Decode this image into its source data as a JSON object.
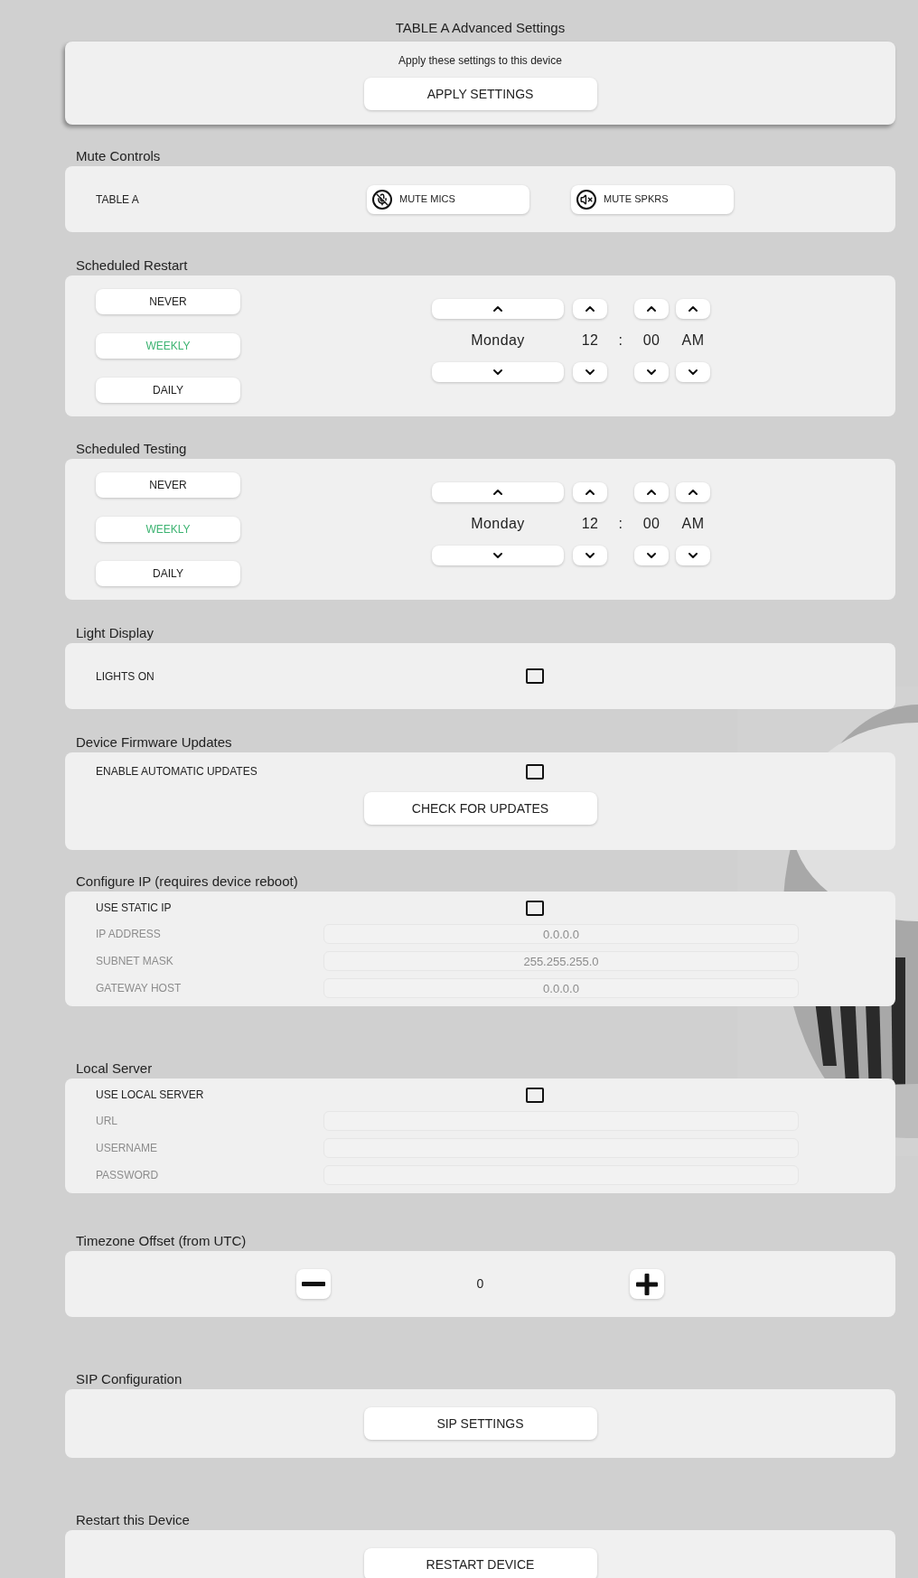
{
  "title": "TABLE A Advanced Settings",
  "apply": {
    "text": "Apply these settings to this device",
    "button": "APPLY SETTINGS"
  },
  "sections": [
    {
      "kind": "mute",
      "heading": "Mute Controls",
      "label": "TABLE A",
      "buttons": [
        {
          "kind": "mic",
          "label": "MUTE MICS"
        },
        {
          "kind": "speaker",
          "label": "MUTE SPKRS"
        }
      ]
    },
    {
      "kind": "schedule",
      "heading": "Scheduled Restart",
      "options": [
        {
          "label": "NEVER",
          "selected": false
        },
        {
          "label": "WEEKLY",
          "selected": true
        },
        {
          "label": "DAILY",
          "selected": false
        }
      ],
      "day": "Monday",
      "hour": "12",
      "separator": ":",
      "minute": "00",
      "period": "AM"
    },
    {
      "kind": "schedule",
      "heading": "Scheduled Testing",
      "options": [
        {
          "label": "NEVER",
          "selected": false
        },
        {
          "label": "WEEKLY",
          "selected": true
        },
        {
          "label": "DAILY",
          "selected": false
        }
      ],
      "day": "Monday",
      "hour": "12",
      "separator": ":",
      "minute": "00",
      "period": "AM"
    },
    {
      "kind": "checkbox",
      "heading": "Light Display",
      "label": "LIGHTS ON",
      "checked": false
    },
    {
      "kind": "firmware",
      "heading": "Device Firmware Updates",
      "label": "ENABLE AUTOMATIC UPDATES",
      "checked": false,
      "button": "CHECK FOR UPDATES"
    },
    {
      "kind": "fields",
      "heading": "Configure IP (requires device reboot)",
      "label": "USE STATIC IP",
      "checked": false,
      "fields": [
        {
          "label": "IP ADDRESS",
          "value": "0.0.0.0",
          "disabled": true
        },
        {
          "label": "SUBNET MASK",
          "value": "255.255.255.0",
          "disabled": true
        },
        {
          "label": "GATEWAY HOST",
          "value": "0.0.0.0",
          "disabled": true
        }
      ]
    },
    {
      "kind": "fields",
      "heading": "Local Server",
      "label": "USE LOCAL SERVER",
      "checked": false,
      "fields": [
        {
          "label": "URL",
          "disabled": true
        },
        {
          "label": "USERNAME",
          "disabled": true
        },
        {
          "label": "PASSWORD",
          "disabled": true
        }
      ]
    },
    {
      "kind": "stepper",
      "heading": "Timezone Offset (from UTC)",
      "value": "0"
    },
    {
      "kind": "button",
      "heading": "SIP Configuration",
      "button": "SIP SETTINGS"
    },
    {
      "kind": "button",
      "heading": "Restart this Device",
      "button": "RESTART DEVICE"
    }
  ]
}
